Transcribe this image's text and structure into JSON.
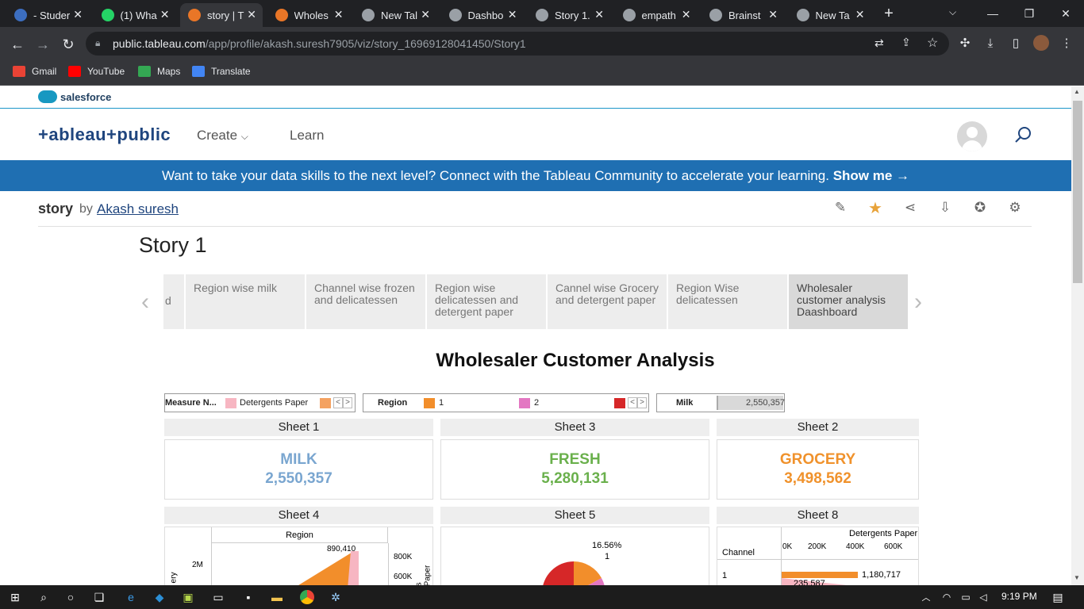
{
  "browser": {
    "tabs": [
      {
        "title": "- Studer",
        "icon": "student-portal-icon",
        "color": "#3c6ec0",
        "active": false
      },
      {
        "title": "(1) Wha",
        "icon": "whatsapp-icon",
        "color": "#25d366",
        "active": false
      },
      {
        "title": "story | T",
        "icon": "tableau-icon",
        "color": "#e97627",
        "active": true
      },
      {
        "title": "Wholes",
        "icon": "tableau-icon",
        "color": "#e97627",
        "active": false
      },
      {
        "title": "New Tal",
        "icon": "chrome-icon",
        "color": "#9aa0a6",
        "active": false
      },
      {
        "title": "Dashbo",
        "icon": "globe-icon",
        "color": "#9aa0a6",
        "active": false
      },
      {
        "title": "Story 1.",
        "icon": "globe-icon",
        "color": "#9aa0a6",
        "active": false
      },
      {
        "title": "empath",
        "icon": "globe-icon",
        "color": "#9aa0a6",
        "active": false
      },
      {
        "title": "Brainst",
        "icon": "globe-icon",
        "color": "#9aa0a6",
        "active": false
      },
      {
        "title": "New Ta",
        "icon": "chrome-icon",
        "color": "#9aa0a6",
        "active": false
      }
    ],
    "url_host": "public.tableau.com",
    "url_path": "/app/profile/akash.suresh7905/viz/story_16969128041450/Story1",
    "bookmarks": [
      {
        "label": "Gmail",
        "color": "#ea4335"
      },
      {
        "label": "YouTube",
        "color": "#ff0000"
      },
      {
        "label": "Maps",
        "color": "#34a853"
      },
      {
        "label": "Translate",
        "color": "#4285f4"
      }
    ]
  },
  "site": {
    "salesforce_label": "salesforce",
    "logo": "+ableau+public",
    "nav": {
      "create": "Create",
      "learn": "Learn"
    },
    "promo_text": "Want to take your data skills to the next level? Connect with the Tableau Community to accelerate your learning.",
    "promo_link": "Show me →"
  },
  "viz": {
    "name": "story",
    "by": "by",
    "author": "Akash suresh",
    "story_title": "Story 1"
  },
  "story_points": [
    {
      "label": "d",
      "active": false
    },
    {
      "label": "Region wise milk",
      "active": false
    },
    {
      "label": "Channel wise frozen and delicatessen",
      "active": false
    },
    {
      "label": "Region wise delicatessen and detergent paper",
      "active": false
    },
    {
      "label": "Cannel wise Grocery and detergent paper",
      "active": false
    },
    {
      "label": "Region Wise delicatessen",
      "active": false
    },
    {
      "label": "Wholesaler customer analysis Daashboard",
      "active": true
    }
  ],
  "dashboard": {
    "title": "Wholesaler Customer Analysis",
    "legends": {
      "measure": {
        "title": "Measure N...",
        "item": "Detergents Paper",
        "color1": "#f7b6c2",
        "color2": "#f4a261"
      },
      "region": {
        "title": "Region",
        "items": [
          {
            "label": "1",
            "color": "#f28e2b"
          },
          {
            "label": "2",
            "color": "#e377c2"
          }
        ],
        "color3": "#d62728"
      },
      "milk": {
        "title": "Milk",
        "value": "2,550,357"
      }
    },
    "kpis": [
      {
        "sheet": "Sheet 1",
        "label": "MILK",
        "value": "2,550,357",
        "color": "#7aa6d0"
      },
      {
        "sheet": "Sheet 3",
        "label": "FRESH",
        "value": "5,280,131",
        "color": "#6ab04c"
      },
      {
        "sheet": "Sheet 2",
        "label": "GROCERY",
        "value": "3,498,562",
        "color": "#f0922c"
      }
    ],
    "sheets_row2": [
      "Sheet 4",
      "Sheet 5",
      "Sheet 8"
    ],
    "sheet4": {
      "header": "Region",
      "label_top": "890,410",
      "y_left": [
        "2M"
      ],
      "y_right": [
        "800K",
        "600K"
      ],
      "right_axis_title": "s Paper",
      "left_axis_title": "ery"
    },
    "sheet5": {
      "pct": "16.56%",
      "label": "1"
    },
    "sheet8": {
      "header": "Detergents Paper",
      "col_title": "Channel",
      "row_label": "1",
      "ticks": [
        "0K",
        "200K",
        "400K",
        "600K"
      ],
      "value1": "1,180,717",
      "value2": "235,587"
    }
  },
  "taskbar": {
    "time": "9:19 PM"
  }
}
